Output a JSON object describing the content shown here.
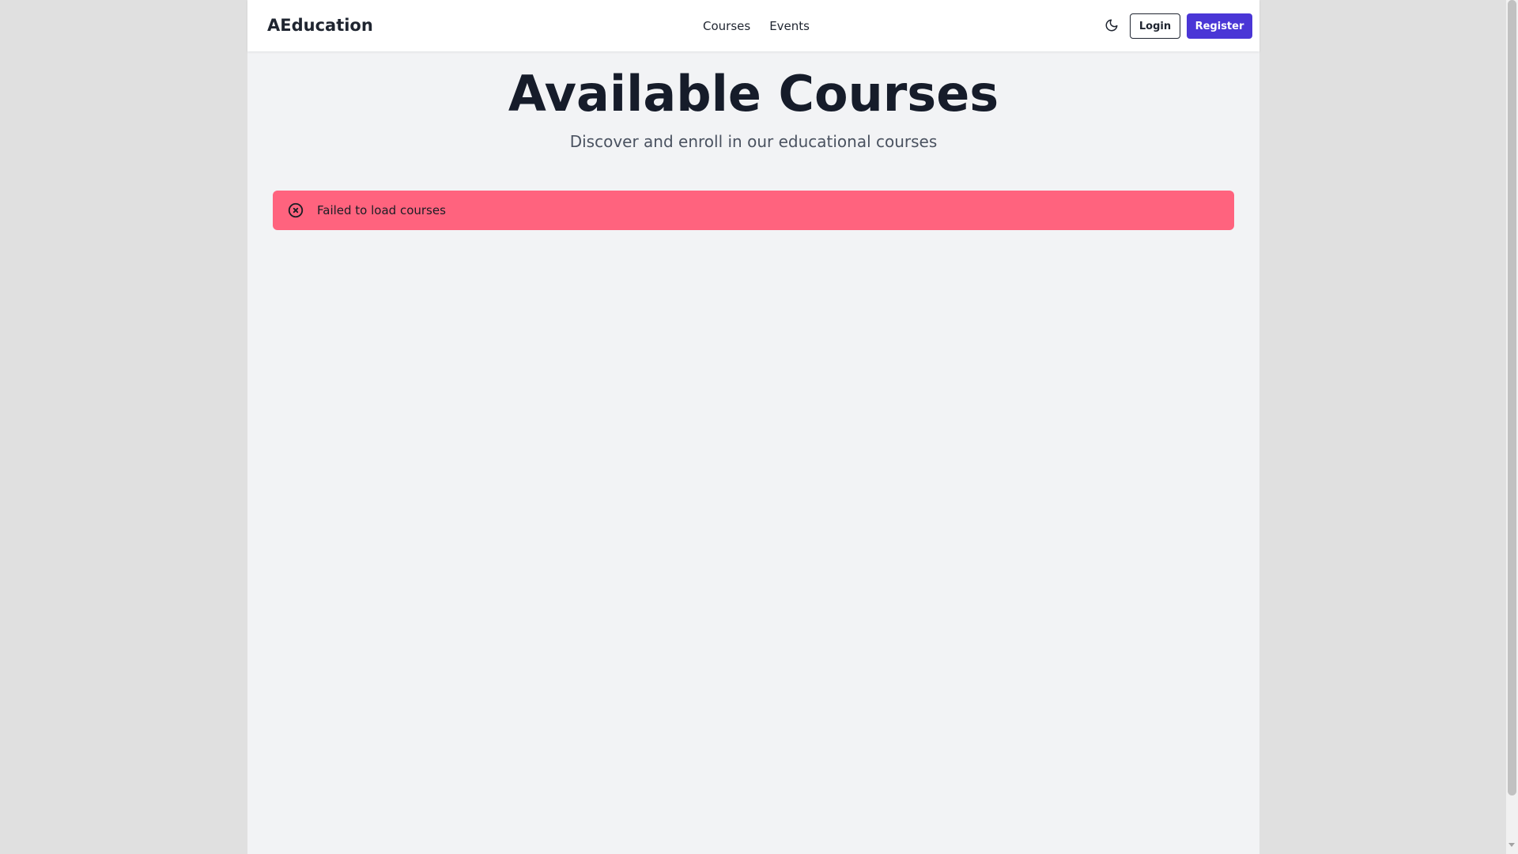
{
  "brand": {
    "name": "AEducation"
  },
  "nav": {
    "links": [
      {
        "label": "Courses"
      },
      {
        "label": "Events"
      }
    ],
    "theme_icon": "moon-icon",
    "login_label": "Login",
    "register_label": "Register"
  },
  "main": {
    "title": "Available Courses",
    "subtitle": "Discover and enroll in our educational courses"
  },
  "alert": {
    "icon": "error-circle-x-icon",
    "message": "Failed to load courses"
  },
  "colors": {
    "page_background": "#f2f3f5",
    "navbar_background": "#ffffff",
    "primary": "#4a36d6",
    "alert_error": "#ff637e",
    "title_text": "#161c2a"
  }
}
